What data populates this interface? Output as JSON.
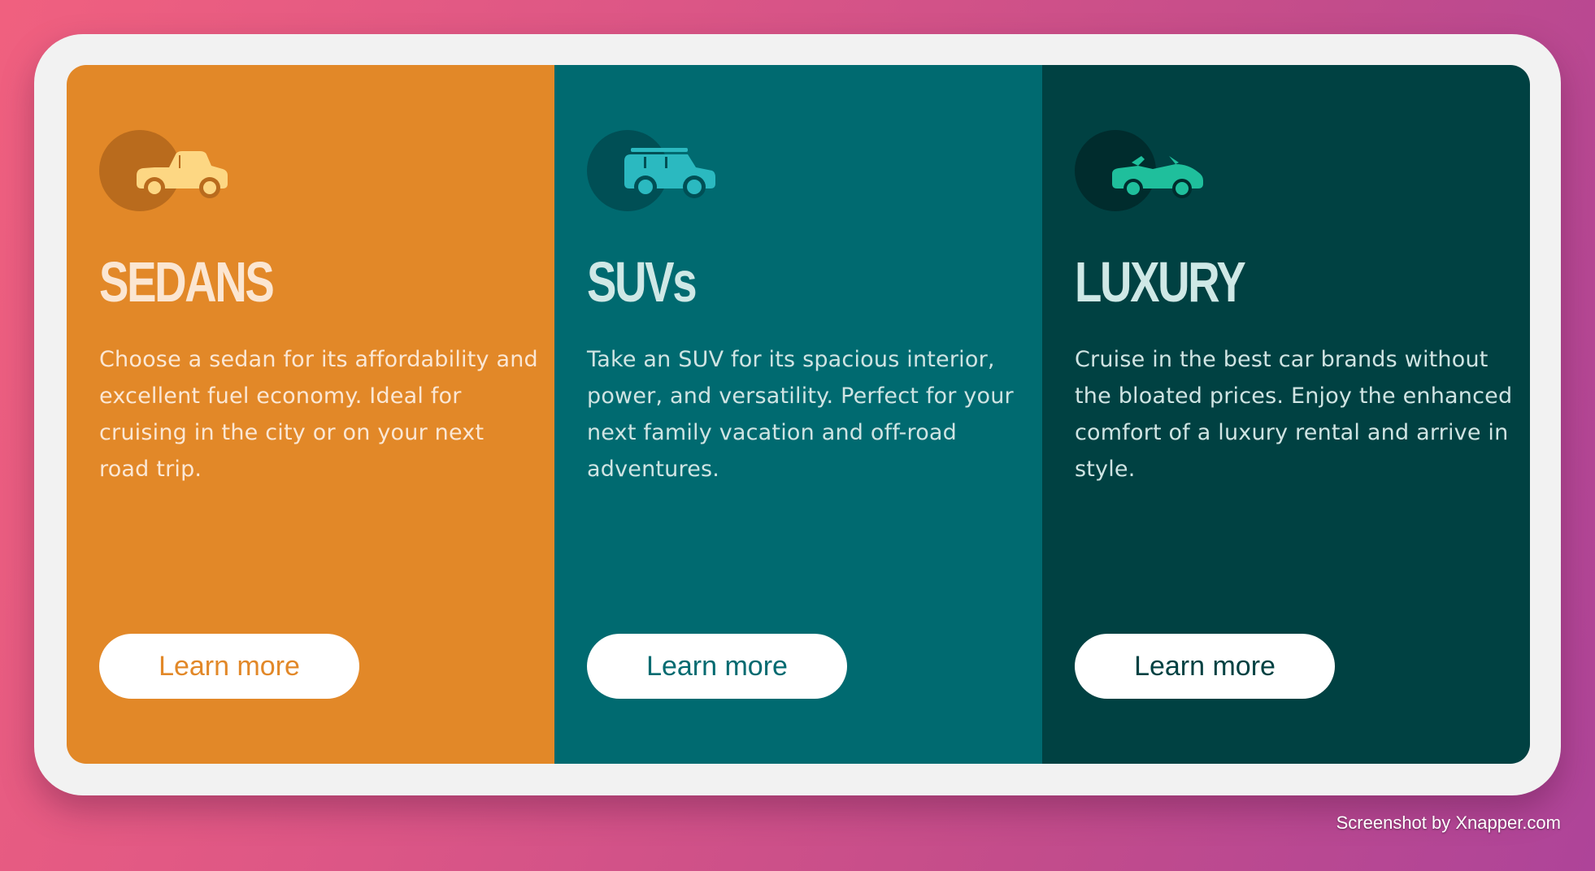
{
  "colors": {
    "background_gradient": [
      "#f0607f",
      "#ae4499"
    ],
    "frame": "#f2f2f2",
    "button_bg": "#ffffff"
  },
  "cards": [
    {
      "icon": "sedan-car-icon",
      "title": "SEDANS",
      "description": "Choose a sedan for its affordability and excellent fuel economy. Ideal for cruising in the city or on your next road trip.",
      "button_label": "Learn more",
      "bg_color": "#e28828",
      "icon_color": "#fdd783"
    },
    {
      "icon": "suv-car-icon",
      "title": "SUVs",
      "description": "Take an SUV for its spacious interior, power, and versatility. Perfect for your next family vacation and off-road adventures.",
      "button_label": "Learn more",
      "bg_color": "#006a70",
      "icon_color": "#2bb9c0"
    },
    {
      "icon": "convertible-car-icon",
      "title": "LUXURY",
      "description": "Cruise in the best car brands without the bloated prices. Enjoy the enhanced comfort of a luxury rental and arrive in style.",
      "button_label": "Learn more",
      "bg_color": "#004142",
      "icon_color": "#1fbf9c"
    }
  ],
  "watermark": "Screenshot by Xnapper.com"
}
